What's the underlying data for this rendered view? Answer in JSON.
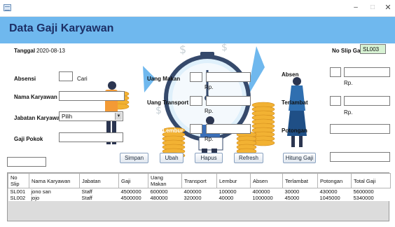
{
  "window": {
    "minimize": "–",
    "maximize": "□",
    "close": "✕"
  },
  "header": {
    "title": "Data Gaji Karyawan"
  },
  "form": {
    "tanggal_label": "Tanggal",
    "tanggal_value": "2020-08-13",
    "slip_label": "No Slip Gaji",
    "slip_value": "SL003",
    "absensi_label": "Absensi",
    "cari_label": "Cari",
    "nama_label": "Nama Karyawan",
    "jabatan_label": "Jabatan Karyawan",
    "jabatan_selected": "Pilih",
    "gaji_pokok_label": "Gaji Pokok",
    "uang_makan_label": "Uang Makan",
    "uang_transport_label": "Uang Transport",
    "uang_lembur_label": "Uang Lembur",
    "rp_label": "Rp.",
    "absen_label": "Absen",
    "terlambat_label": "Terlambat",
    "potongan_label": "Potongan"
  },
  "buttons": {
    "simpan": "Simpan",
    "ubah": "Ubah",
    "hapus": "Hapus",
    "refresh": "Refresh",
    "hitung": "Hitung Gaji"
  },
  "table": {
    "columns": [
      "No Slip",
      "Nama Karyawan",
      "Jabatan",
      "Gaji",
      "Uang Makan",
      "Transport",
      "Lembur",
      "Absen",
      "Terlambat",
      "Potongan",
      "Total Gaji"
    ],
    "rows": [
      [
        "SL001",
        "jono san",
        "Staff",
        "4500000",
        "600000",
        "400000",
        "100000",
        "400000",
        "30000",
        "430000",
        "5600000"
      ],
      [
        "SL002",
        "jojo",
        "Staff",
        "4500000",
        "480000",
        "320000",
        "40000",
        "1000000",
        "45000",
        "1045000",
        "5340000"
      ]
    ]
  },
  "colors": {
    "header": "#6fb8ee",
    "title": "#1c2f66",
    "slip_field": "#d7f2d3"
  }
}
